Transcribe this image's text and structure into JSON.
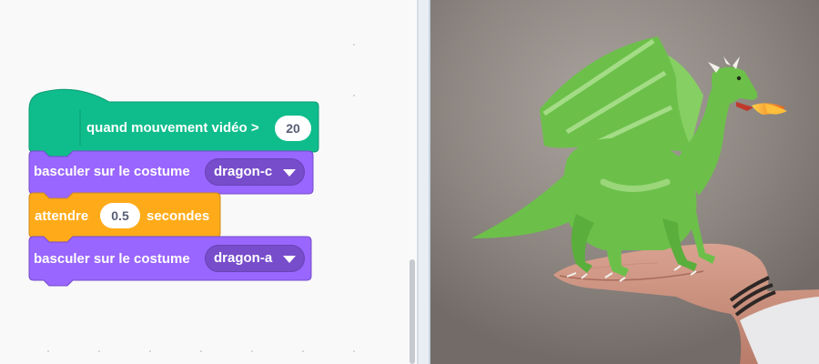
{
  "script": {
    "hat_block": {
      "label": "quand mouvement vidéo >",
      "value": "20"
    },
    "switch_costume_1": {
      "label": "basculer sur le costume",
      "costume": "dragon-c"
    },
    "wait_block": {
      "label_before": "attendre",
      "value": "0.5",
      "label_after": "secondes"
    },
    "switch_costume_2": {
      "label": "basculer sur le costume",
      "costume": "dragon-a"
    }
  },
  "colors": {
    "event_block": "#0fbd8c",
    "looks_block": "#9966ff",
    "control_block": "#ffab19",
    "stage_background": "#8e8782",
    "dragon": "#6cc04a"
  },
  "icons": {
    "dropdown": "triangle-down-icon"
  }
}
